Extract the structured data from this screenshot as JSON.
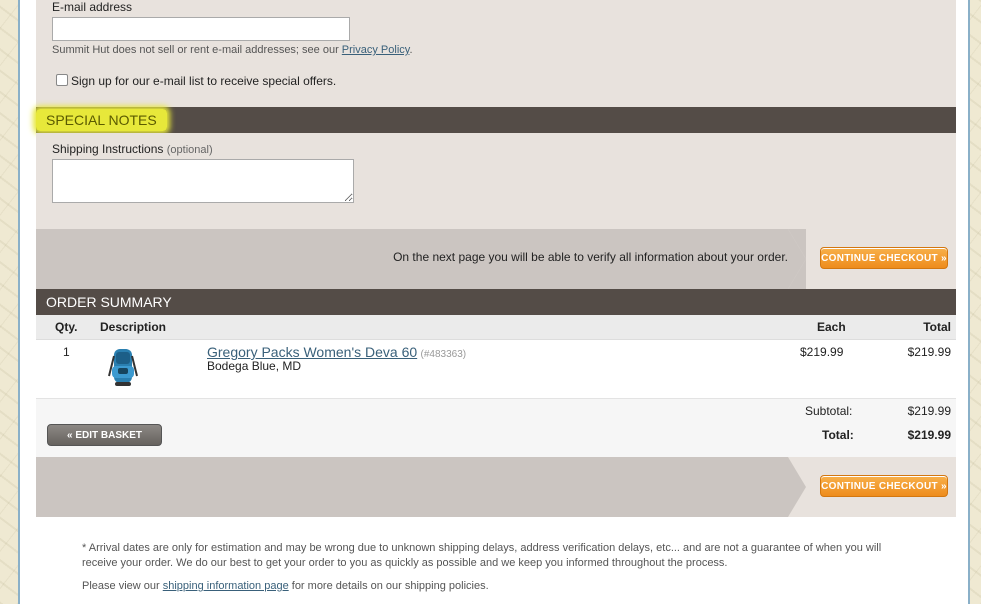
{
  "email": {
    "label": "E-mail address",
    "value": "",
    "privacy_text": "Summit Hut does not sell or rent e-mail addresses; see our ",
    "privacy_link": "Privacy Policy",
    "privacy_end": ".",
    "signup_label": "Sign up for our e-mail list to receive special offers."
  },
  "special_notes": {
    "title": "SPECIAL NOTES",
    "shipping_label": "Shipping Instructions",
    "shipping_optional": "(optional)",
    "shipping_value": ""
  },
  "checkout_band": {
    "message": "On the next page you will be able to verify all information about your order.",
    "button_label": "CONTINUE CHECKOUT »"
  },
  "order_summary": {
    "title": "ORDER SUMMARY",
    "columns": {
      "qty": "Qty.",
      "description": "Description",
      "each": "Each",
      "total": "Total"
    },
    "items": [
      {
        "qty": "1",
        "name": "Gregory Packs Women's Deva 60",
        "sku": "(#483363)",
        "variant": "Bodega Blue, MD",
        "each": "$219.99",
        "total": "$219.99"
      }
    ],
    "subtotal_label": "Subtotal:",
    "subtotal_value": "$219.99",
    "total_label": "Total:",
    "total_value": "$219.99",
    "edit_basket_label": "« EDIT BASKET"
  },
  "footer": {
    "arrival_note": "* Arrival dates are only for estimation and may be wrong due to unknown shipping delays, address verification delays, etc... and are not a guarantee of when you will receive your order. We do our best to get your order to you as quickly as possible and we keep you informed throughout the process.",
    "shipping_pre": "Please view our ",
    "shipping_link": "shipping information page",
    "shipping_post": " for more details on our shipping policies."
  }
}
